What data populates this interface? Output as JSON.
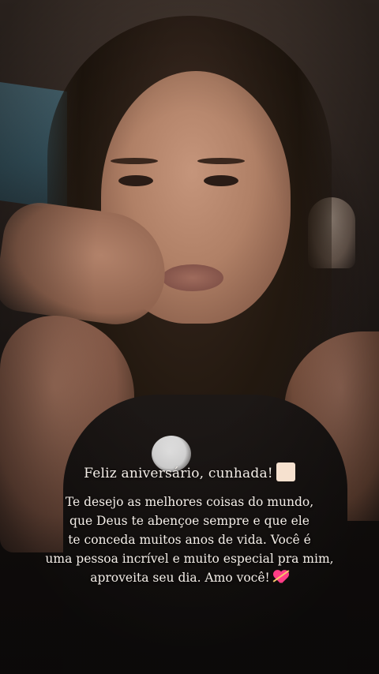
{
  "story": {
    "title": "Feliz aniversário, cunhada!",
    "title_emoji_icon": "skin-tone-emoji-icon",
    "message_lines": [
      "Te desejo as melhores coisas do mundo,",
      "que Deus te abençoe sempre e que ele",
      "te conceda muitos anos de vida. Você é",
      "uma pessoa incrível e muito especial pra mim,",
      "aproveita seu dia. Amo você!"
    ],
    "message_emoji_icon": "heart-with-arrow-icon",
    "colors": {
      "caption_text": "#f4eee8",
      "heart": "#ff3d86",
      "emoji_box": "#f6e1cf"
    }
  }
}
